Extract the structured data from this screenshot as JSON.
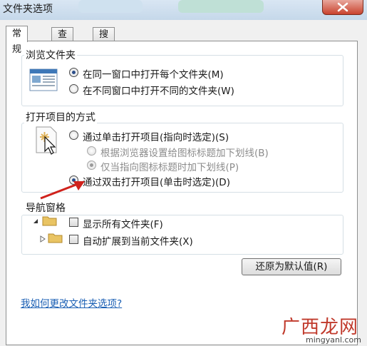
{
  "window": {
    "title": "文件夹选项"
  },
  "tabs": [
    {
      "label": "常规",
      "active": true
    },
    {
      "label": "查看",
      "active": false
    },
    {
      "label": "搜索",
      "active": false
    }
  ],
  "browse_group": {
    "label": "浏览文件夹",
    "options": [
      {
        "label": "在同一窗口中打开每个文件夹(M)",
        "checked": true
      },
      {
        "label": "在不同窗口中打开不同的文件夹(W)",
        "checked": false
      }
    ]
  },
  "click_group": {
    "label": "打开项目的方式",
    "options": [
      {
        "label": "通过单击打开项目(指向时选定)(S)",
        "checked": false
      },
      {
        "label": "根据浏览器设置给图标标题加下划线(B)",
        "checked": false,
        "disabled": true
      },
      {
        "label": "仅当指向图标标题时加下划线(P)",
        "checked": true,
        "disabled": true
      },
      {
        "label": "通过双击打开项目(单击时选定)(D)",
        "checked": true
      }
    ]
  },
  "nav_group": {
    "label": "导航窗格",
    "options": [
      {
        "label": "显示所有文件夹(F)",
        "checked": false
      },
      {
        "label": "自动扩展到当前文件夹(X)",
        "checked": false
      }
    ]
  },
  "restore_button": {
    "label": "还原为默认值(R)"
  },
  "help_link": {
    "label": "我如何更改文件夹选项?"
  },
  "watermark": {
    "brand": "广西龙网",
    "url": "mingyanl.com"
  },
  "colors": {
    "arrow": "#d0221c",
    "link": "#1a5fb4",
    "watermark": "#c0392b"
  }
}
